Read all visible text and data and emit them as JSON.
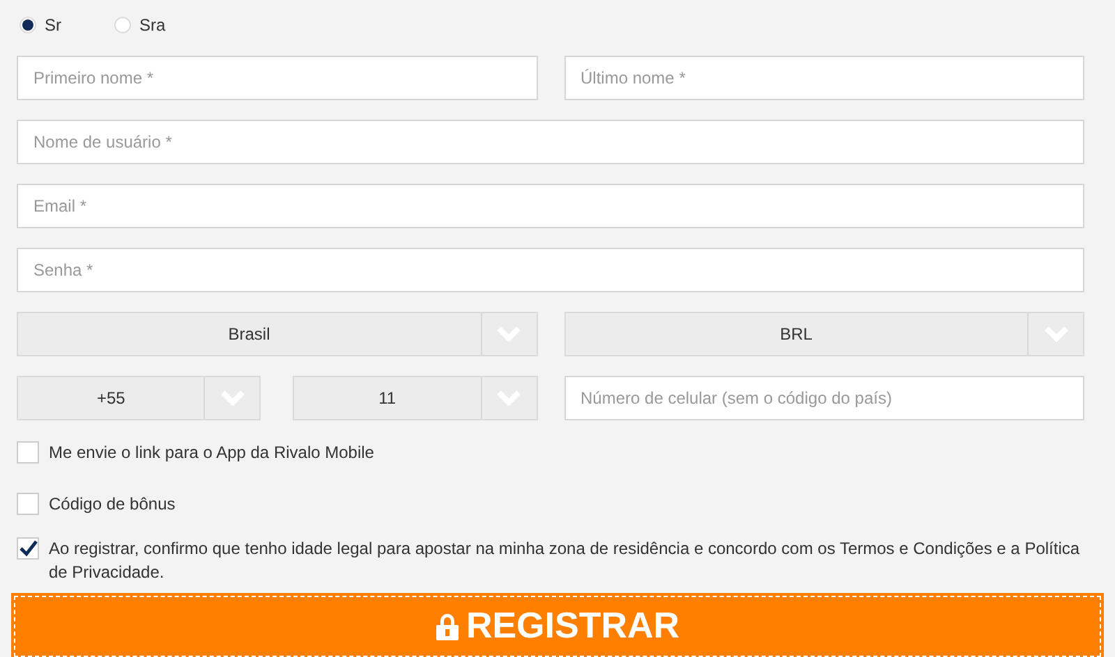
{
  "title_options": [
    {
      "label": "Sr",
      "selected": true
    },
    {
      "label": "Sra",
      "selected": false
    }
  ],
  "rows": [
    {
      "kind": "pair",
      "fields": [
        {
          "placeholder": "Primeiro nome *"
        },
        {
          "placeholder": "Último nome *"
        }
      ]
    },
    {
      "kind": "single",
      "fields": [
        {
          "placeholder": "Nome de usuário *"
        }
      ]
    },
    {
      "kind": "single",
      "fields": [
        {
          "placeholder": "Email *"
        }
      ]
    },
    {
      "kind": "single",
      "fields": [
        {
          "placeholder": "Senha *"
        }
      ]
    }
  ],
  "country_select": {
    "value": "Brasil"
  },
  "currency_select": {
    "value": "BRL"
  },
  "phone": {
    "country_code": "+55",
    "area_code": "11",
    "number_placeholder": "Número de celular (sem o código do país)"
  },
  "checkboxes": [
    {
      "label": "Me envie o link para o App da Rivalo Mobile",
      "checked": false
    },
    {
      "label": "Código de bônus",
      "checked": false
    },
    {
      "label": "Ao registrar, confirmo que tenho idade legal para apostar na minha zona de residência e concordo com os Termos e Condições e a Política de Privacidade.",
      "checked": true
    }
  ],
  "submit_button": "REGISTRAR"
}
